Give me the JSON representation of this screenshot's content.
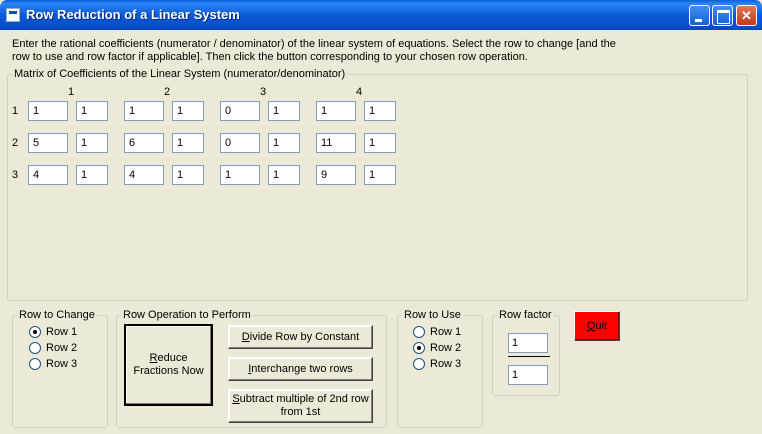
{
  "window": {
    "title": "Row Reduction of a Linear System"
  },
  "instructions": "Enter the rational coefficients (numerator / denominator) of the linear system of equations.   Select the row to change [and the row to use and row factor if applicable].   Then click the button corresponding to your chosen row operation.",
  "matrix": {
    "legend": "Matrix of Coefficients of the Linear System   (numerator/denominator)",
    "column_headers": [
      "1",
      "2",
      "3",
      "4"
    ],
    "row_labels": [
      "1",
      "2",
      "3"
    ],
    "rows": [
      [
        {
          "num": "1",
          "den": "1"
        },
        {
          "num": "1",
          "den": "1"
        },
        {
          "num": "0",
          "den": "1"
        },
        {
          "num": "1",
          "den": "1"
        }
      ],
      [
        {
          "num": "5",
          "den": "1"
        },
        {
          "num": "6",
          "den": "1"
        },
        {
          "num": "0",
          "den": "1"
        },
        {
          "num": "11",
          "den": "1"
        }
      ],
      [
        {
          "num": "4",
          "den": "1"
        },
        {
          "num": "4",
          "den": "1"
        },
        {
          "num": "1",
          "den": "1"
        },
        {
          "num": "9",
          "den": "1"
        }
      ]
    ]
  },
  "row_to_change": {
    "legend": "Row to Change",
    "options": [
      {
        "label": "Row 1",
        "selected": true
      },
      {
        "label": "Row 2",
        "selected": false
      },
      {
        "label": "Row 3",
        "selected": false
      }
    ]
  },
  "row_operation": {
    "legend": "Row Operation to Perform",
    "reduce": {
      "line1": "Reduce",
      "mnemonic": "R",
      "rest": "educe",
      "line2": "Fractions Now"
    },
    "divide": {
      "mnemonic": "D",
      "rest": "ivide Row by Constant"
    },
    "interchange": {
      "mnemonic": "I",
      "rest": "nterchange two rows"
    },
    "subtract": {
      "mnemonic": "S",
      "rest": "ubtract multiple of 2nd row",
      "line2": "from 1st"
    }
  },
  "row_to_use": {
    "legend": "Row to Use",
    "options": [
      {
        "label": "Row 1",
        "selected": false
      },
      {
        "label": "Row 2",
        "selected": true
      },
      {
        "label": "Row 3",
        "selected": false
      }
    ]
  },
  "row_factor": {
    "legend": "Row factor",
    "numerator": "1",
    "denominator": "1"
  },
  "quit": {
    "mnemonic": "Q",
    "rest": "uit"
  }
}
